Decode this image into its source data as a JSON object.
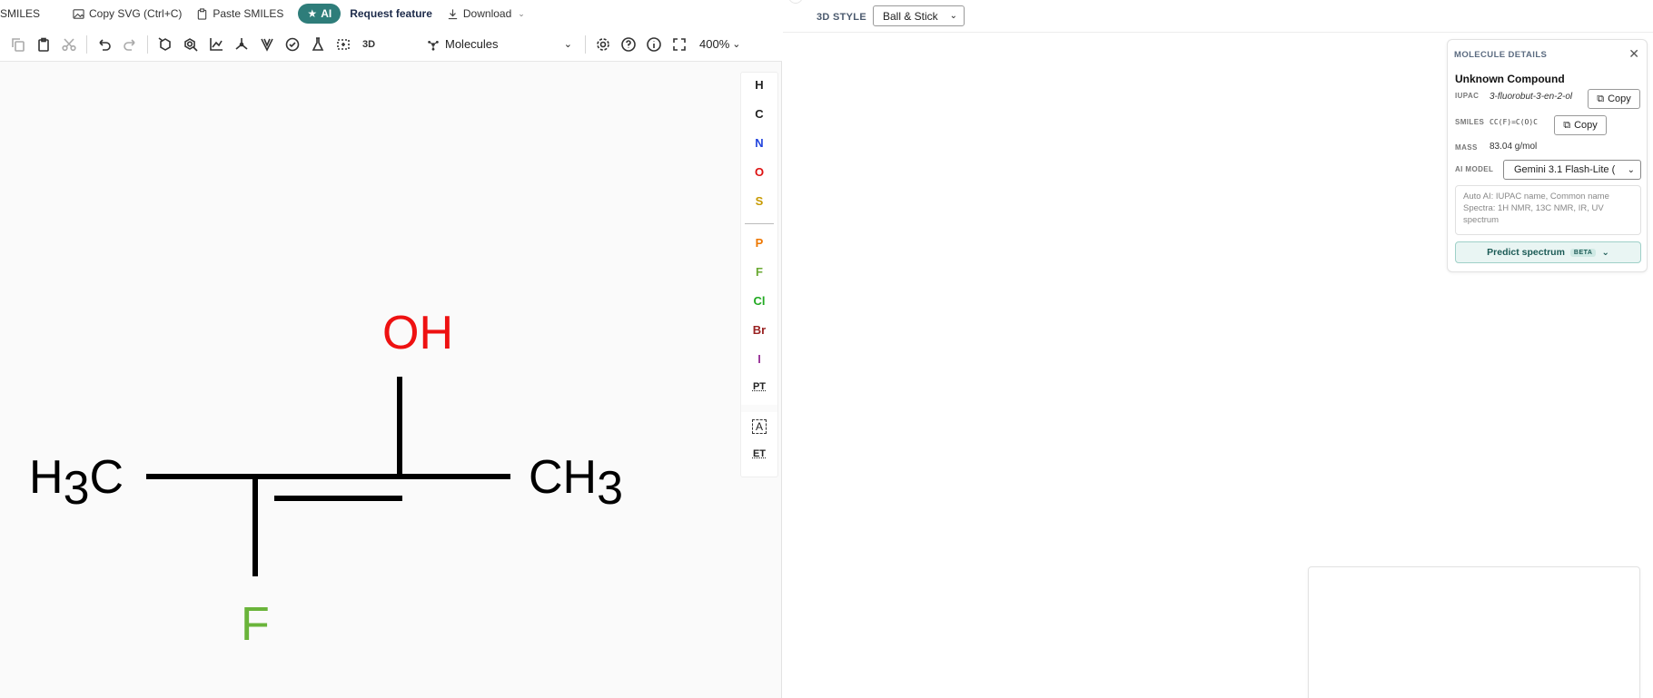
{
  "topbar": {
    "smiles_label": "SMILES",
    "copy_svg_label": "Copy SVG (Ctrl+C)",
    "paste_smiles_label": "Paste SMILES",
    "ai_label": "AI",
    "request_feature_label": "Request feature",
    "download_label": "Download"
  },
  "toolbar": {
    "molecules_label": "Molecules",
    "zoom_label": "400%",
    "threed_label": "3D"
  },
  "palette": {
    "elements": [
      {
        "symbol": "H",
        "color": "#111111"
      },
      {
        "symbol": "C",
        "color": "#111111"
      },
      {
        "symbol": "N",
        "color": "#2244dd"
      },
      {
        "symbol": "O",
        "color": "#dd1111"
      },
      {
        "symbol": "S",
        "color": "#c79a00"
      },
      {
        "symbol": "P",
        "color": "#ee7700"
      },
      {
        "symbol": "F",
        "color": "#6aaa33"
      },
      {
        "symbol": "Cl",
        "color": "#22aa22"
      },
      {
        "symbol": "Br",
        "color": "#992222"
      },
      {
        "symbol": "I",
        "color": "#993399"
      }
    ],
    "pt_label": "PT",
    "text_tool_label": "A",
    "et_label": "ET"
  },
  "structure": {
    "left_group": {
      "main": "H",
      "sub": "3",
      "tail": "C"
    },
    "right_group": {
      "main": "CH",
      "sub": "3"
    },
    "hydroxyl": "OH",
    "fluorine": "F",
    "colors": {
      "bond": "#000000",
      "oxygen": "#ee1111",
      "fluorine": "#6ab43a",
      "carbon": "#000000"
    }
  },
  "viewer": {
    "style_label": "3D STYLE",
    "style_value": "Ball & Stick"
  },
  "details": {
    "title": "MOLECULE DETAILS",
    "compound_name": "Unknown Compound",
    "iupac_label": "IUPAC",
    "iupac_value": "3-fluorobut-3-en-2-ol",
    "smiles_label": "SMILES",
    "smiles_value": "CC(F)=C(O)C",
    "mass_label": "MASS",
    "mass_value": "83.04 g/mol",
    "copy_label": "Copy",
    "ai_model_label": "AI MODEL",
    "ai_model_value": "Gemini 3.1 Flash-Lite (",
    "auto_ai_line1": "Auto AI: IUPAC name, Common name",
    "auto_ai_line2": "Spectra: 1H NMR, 13C NMR, IR, UV spectrum",
    "predict_label": "Predict spectrum",
    "beta_label": "BETA"
  },
  "accent_color": "#2e7d7a"
}
